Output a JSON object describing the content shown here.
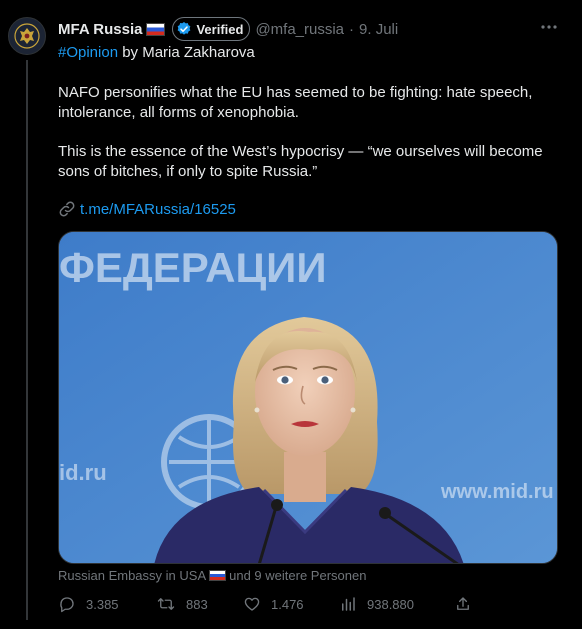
{
  "author": {
    "name": "MFA Russia",
    "verified_label": "Verified",
    "handle": "@mfa_russia",
    "separator": "·",
    "date": "9. Juli"
  },
  "tweet": {
    "line1_hashtag": "#Opinion",
    "line1_rest": " by Maria Zakharova",
    "para1": "NAFO personifies what the EU has seemed to be fighting: hate speech, intolerance, all forms of xenophobia.",
    "para2": "This is the essence of the West’s hypocrisy — “we ourselves will become sons of bitches, if only to spite Russia.”",
    "link": "t.me/MFARussia/16525"
  },
  "media": {
    "backdrop_text_top": "ФЕДЕРАЦИИ",
    "backdrop_text_left": "id.ru",
    "backdrop_text_right": "www.mid.ru"
  },
  "tags": {
    "first": "Russian Embassy in USA",
    "rest": "und 9 weitere Personen"
  },
  "actions": {
    "replies": "3.385",
    "reposts": "883",
    "likes": "1.476",
    "views": "938.880"
  },
  "colors": {
    "background": "#000000",
    "text": "#e7e9ea",
    "muted": "#71767b",
    "link": "#1d9bf0",
    "verified_badge": "#1d9bf0",
    "photo_backdrop": "#4a83c8"
  },
  "icons": [
    "mfa-emblem-icon",
    "russia-flag-icon",
    "verified-badge-icon",
    "more-icon",
    "link-icon",
    "reply-icon",
    "repost-icon",
    "like-icon",
    "views-icon",
    "share-icon"
  ]
}
